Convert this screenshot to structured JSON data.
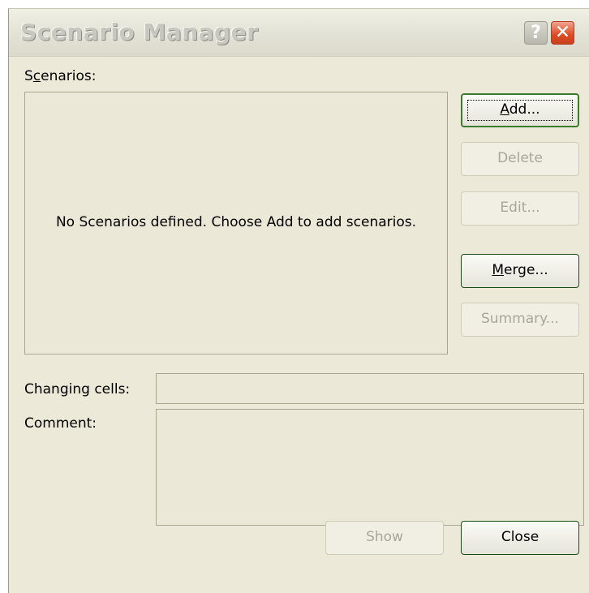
{
  "dialog": {
    "title": "Scenario Manager",
    "help_glyph": "?",
    "close_glyph": "✕"
  },
  "scenarios": {
    "label_pre": "S",
    "label_access": "c",
    "label_post": "enarios:",
    "empty_message": "No Scenarios defined. Choose Add to add scenarios."
  },
  "buttons": {
    "add": {
      "access": "A",
      "rest": "dd...",
      "enabled": true,
      "default": true
    },
    "delete": {
      "label": "Delete",
      "enabled": false
    },
    "edit": {
      "label": "Edit...",
      "enabled": false
    },
    "merge": {
      "access": "M",
      "rest": "erge...",
      "enabled": true
    },
    "summary": {
      "label": "Summary...",
      "enabled": false
    },
    "show": {
      "label": "Show",
      "enabled": false
    },
    "close": {
      "label": "Close",
      "enabled": true
    }
  },
  "fields": {
    "changing_cells_label": "Changing cells:",
    "changing_cells_value": "",
    "comment_label": "Comment:",
    "comment_value": ""
  },
  "colors": {
    "dialog_bg": "#ece9d8",
    "default_button_border": "#3c7a2c",
    "close_button": "#dc4a25"
  }
}
